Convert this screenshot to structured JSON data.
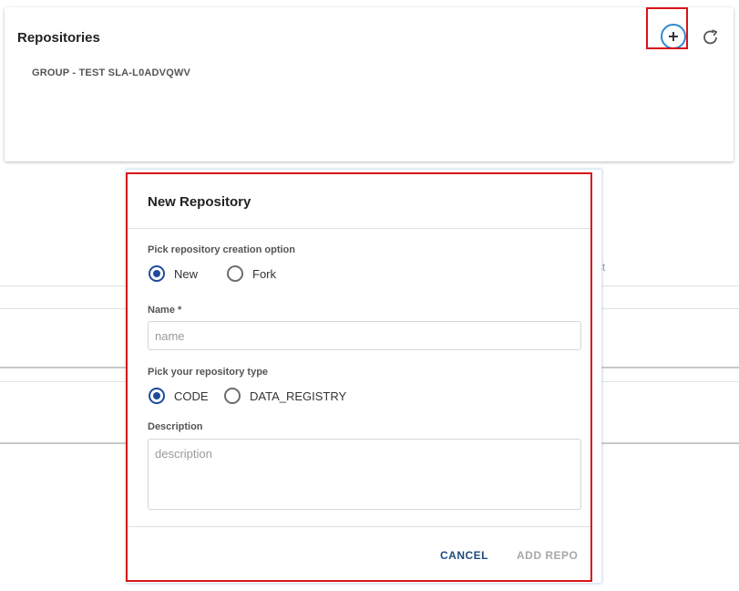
{
  "panel": {
    "title": "Repositories",
    "group_label": "GROUP - TEST SLA-L0ADVQWV",
    "add_button": "add-repository",
    "refresh_button": "refresh"
  },
  "background": {
    "partial_text": "st"
  },
  "modal": {
    "title": "New Repository",
    "creation_option_label": "Pick repository creation option",
    "creation_options": [
      {
        "label": "New",
        "selected": true
      },
      {
        "label": "Fork",
        "selected": false
      }
    ],
    "name_label": "Name *",
    "name_placeholder": "name",
    "name_value": "",
    "type_label": "Pick your repository type",
    "type_options": [
      {
        "label": "CODE",
        "selected": true
      },
      {
        "label": "DATA_REGISTRY",
        "selected": false
      }
    ],
    "description_label": "Description",
    "description_placeholder": "description",
    "description_value": "",
    "cancel_label": "CANCEL",
    "add_repo_label": "ADD REPO"
  },
  "colors": {
    "accent": "#1f4b9b",
    "highlight": "#d8141a",
    "add_ring": "#2f8ad0",
    "disabled": "#a9a9a9"
  }
}
